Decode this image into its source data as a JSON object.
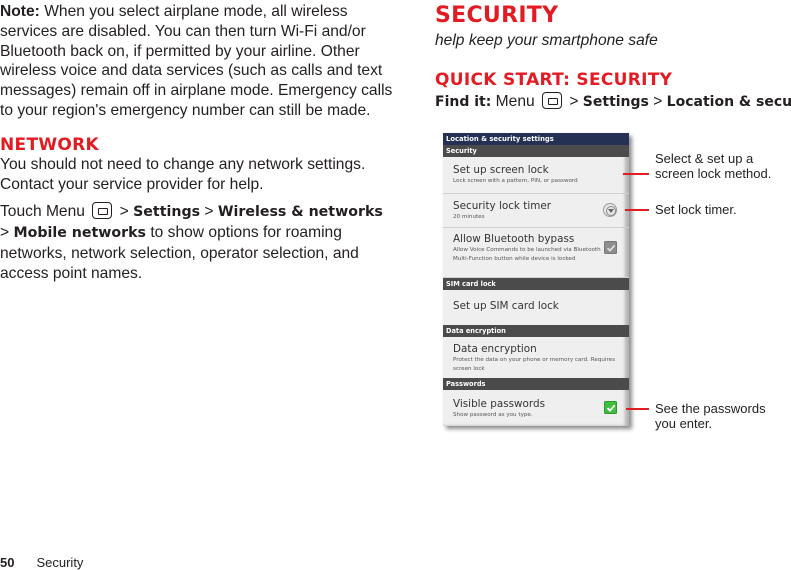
{
  "left": {
    "note": {
      "label": "Note:",
      "text": " When you select airplane mode, all wireless services are disabled. You can then turn Wi-Fi and/or Bluetooth back on, if permitted by your airline. Other wireless voice and data services (such as calls and text messages) remain off in airplane mode. Emergency calls to your region's emergency number can still be made."
    },
    "network": {
      "heading": "NETWORK",
      "intro": "You should not need to change any network settings. Contact your service provider for help.",
      "touch": "Touch Menu",
      "sep": " > ",
      "settings": "Settings",
      "wireless": "Wireless & networks",
      "mobile": "Mobile networks",
      "tail": " to show options for roaming networks, network selection, operator selection, and access point names."
    }
  },
  "right": {
    "heading": "SECURITY",
    "subtitle": "help keep your smartphone safe",
    "quickstart": {
      "heading": "QUICK START: SECURITY",
      "find_label": "Find it:",
      "menu": " Menu",
      "sep": " > ",
      "settings": "Settings",
      "location": "Location & security"
    }
  },
  "phone": {
    "title": "Location & security settings",
    "sections": {
      "security": "Security",
      "sim": "SIM card lock",
      "encryption": "Data encryption",
      "passwords": "Passwords"
    },
    "items": [
      {
        "title": "Set up screen lock",
        "summary": "Lock screen with a pattern, PIN, or password"
      },
      {
        "title": "Security lock timer",
        "summary": "20 minutes"
      },
      {
        "title": "Allow Bluetooth bypass",
        "summary": "Allow Voice Commands to be launched via Bluetooth Multi-Function button while device is locked",
        "checked": true
      },
      {
        "title": "Set up SIM card lock"
      },
      {
        "title": "Data encryption",
        "summary": "Protect the data on your phone or memory card. Requires screen lock"
      },
      {
        "title": "Visible passwords",
        "summary": "Show password as you type.",
        "checked": true
      }
    ]
  },
  "callouts": {
    "screen_lock": "Select & set up a screen lock method.",
    "timer": "Set lock timer.",
    "passwords": "See the passwords you enter."
  },
  "footer": {
    "page_number": "50",
    "section": "Security"
  },
  "colors": {
    "accent_red": "#e31b23",
    "titlebar": "#243154",
    "section_header": "#4b4b4b",
    "check_green": "#3cbf3c"
  }
}
